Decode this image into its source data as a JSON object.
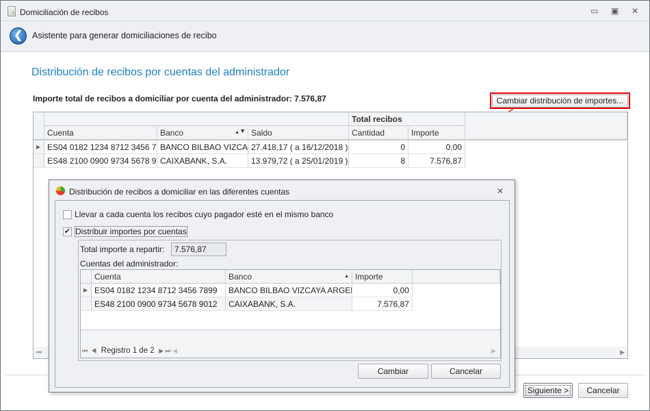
{
  "window": {
    "title": "Domiciliación de recibos",
    "minimize": "▭",
    "restore": "▣",
    "close": "✕"
  },
  "header": {
    "subtitle": "Asistente para generar domiciliaciones de recibo"
  },
  "main": {
    "heading": "Distribución de recibos por cuentas del administrador",
    "total_label": "Importe total de recibos a domiciliar por cuenta del administrador: 7.576,87",
    "change_button": "Cambiar distribución de importes...",
    "band": "Total recibos",
    "columns": [
      "Cuenta",
      "Banco",
      "Saldo",
      "Cantidad",
      "Importe"
    ],
    "rows": [
      {
        "cuenta": "ES04 0182 1234 8712 3456 7...",
        "banco": "BANCO BILBAO VIZCA...",
        "saldo": "27.418,17 ( a 16/12/2018 )",
        "cantidad": "0",
        "importe": "0,00"
      },
      {
        "cuenta": "ES48 2100 0900 9734 5678 9...",
        "banco": "CAIXABANK, S.A.",
        "saldo": "13.979,72 ( a 25/01/2019 )",
        "cantidad": "8",
        "importe": "7.576,87"
      }
    ]
  },
  "footer": {
    "next": "Siguiente >",
    "cancel": "Cancelar"
  },
  "dialog": {
    "title": "Distribución de recibos a domiciliar en las diferentes cuentas",
    "close": "✕",
    "option1": "Llevar a cada cuenta los recibos cuyo pagador esté en el mismo banco",
    "option1_checked": false,
    "option2": "Distribuir importes por cuentas",
    "option2_checked": true,
    "total_label": "Total importe a repartir:",
    "total_value": "7.576,87",
    "accounts_label": "Cuentas del administrador:",
    "columns": [
      "Cuenta",
      "Banco",
      "Importe"
    ],
    "rows": [
      {
        "cuenta": "ES04 0182 1234 8712 3456 7899",
        "banco": "BANCO BILBAO VIZCAYA ARGENT...",
        "importe": "0,00"
      },
      {
        "cuenta": "ES48 2100 0900 9734 5678 9012",
        "banco": "CAIXABANK, S.A.",
        "importe": "7.576,87"
      }
    ],
    "navigator": "Registro 1 de 2",
    "change": "Cambiar",
    "cancel": "Cancelar"
  },
  "colors": {
    "heading": "#1e7fc2",
    "highlight": "#e00000"
  }
}
